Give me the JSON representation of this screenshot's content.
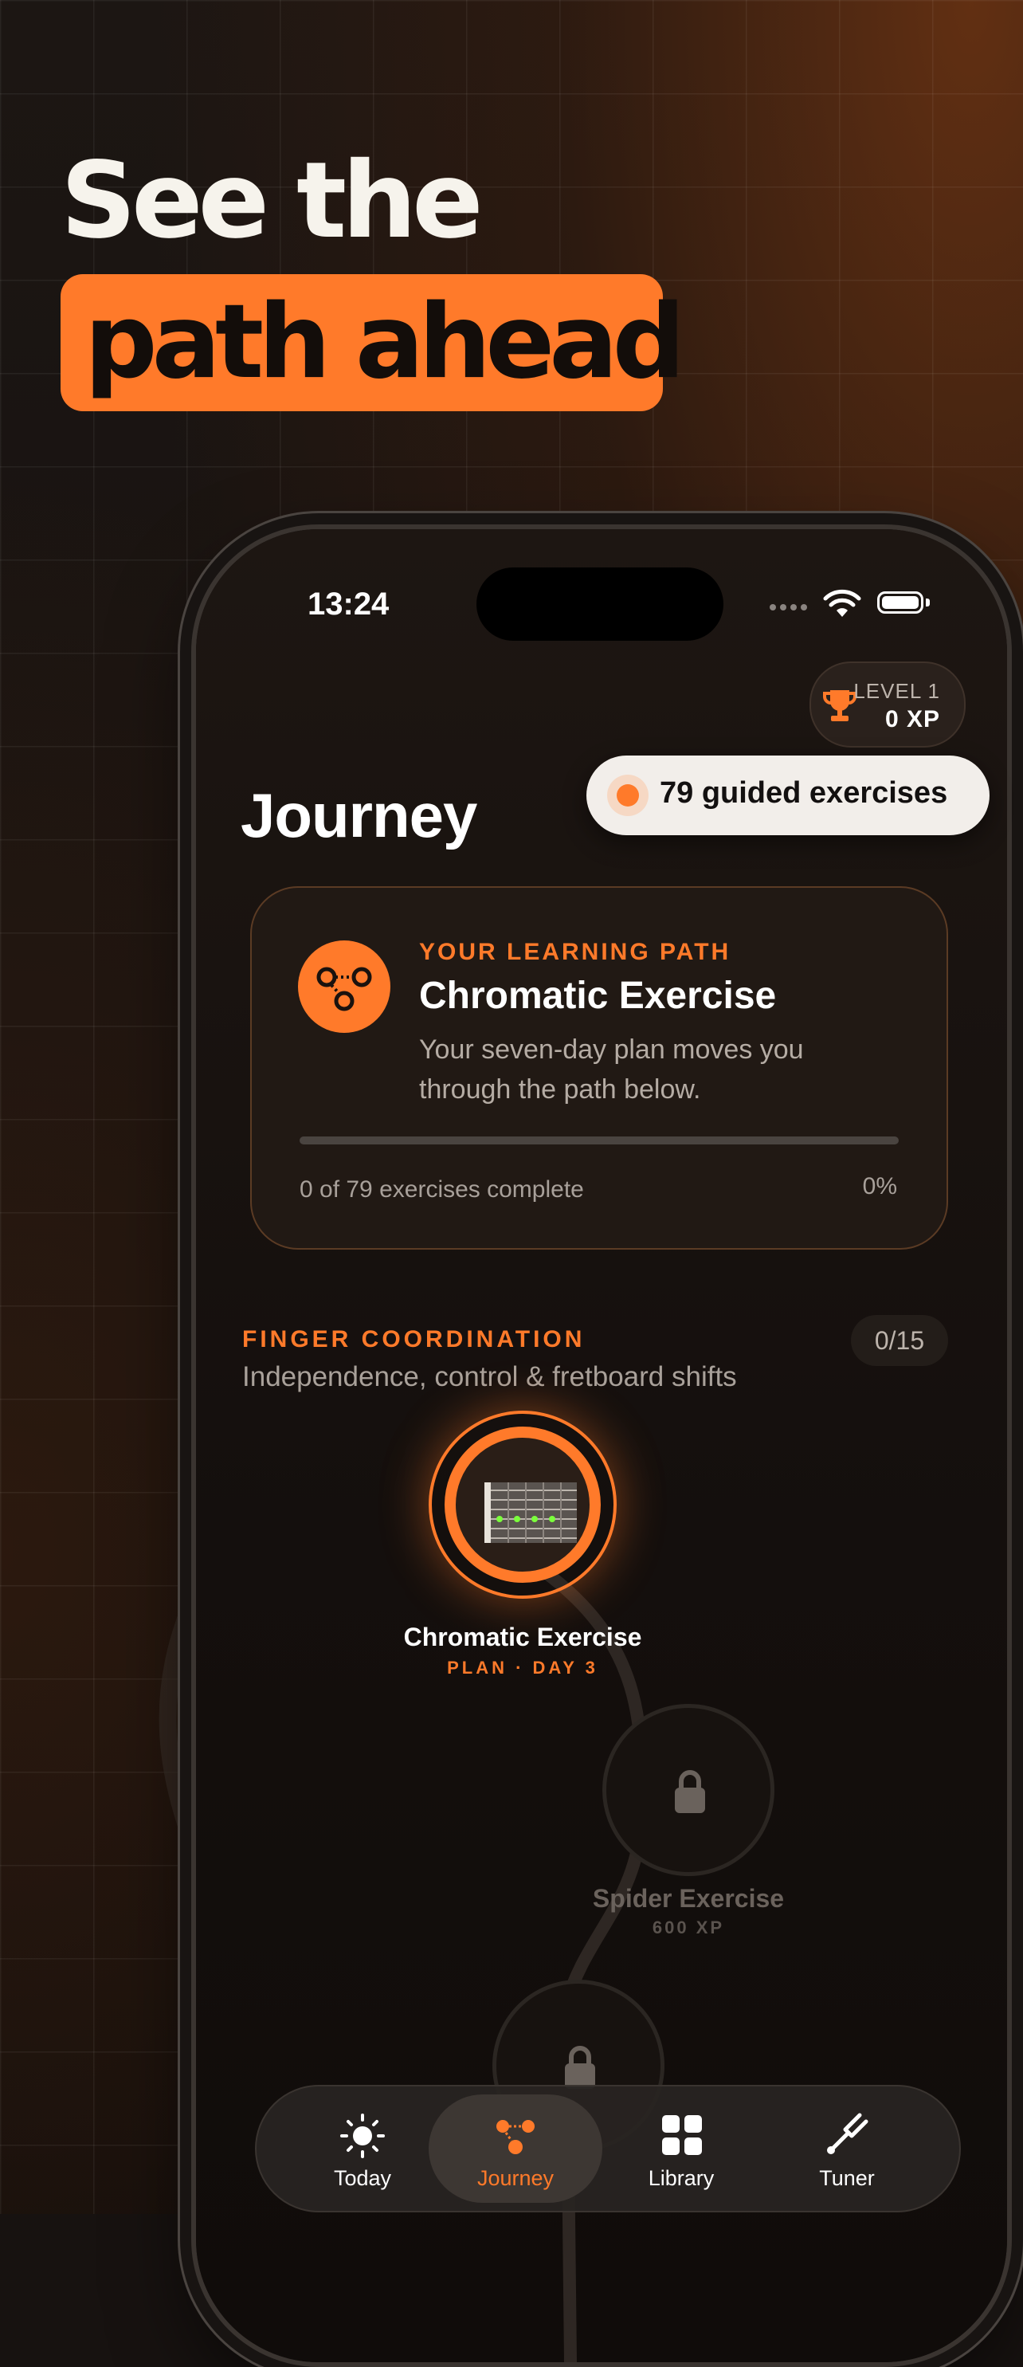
{
  "marketing": {
    "headline_line1": "See the",
    "headline_line2": "path ahead"
  },
  "status_bar": {
    "time": "13:24"
  },
  "level": {
    "label": "LEVEL 1",
    "xp": "0 XP"
  },
  "guided_badge": {
    "text": "79 guided exercises"
  },
  "page": {
    "title": "Journey"
  },
  "learning_card": {
    "eyebrow": "YOUR LEARNING PATH",
    "title": "Chromatic Exercise",
    "description": "Your seven-day plan moves you through the path below.",
    "progress_text": "0 of 79 exercises complete",
    "progress_percent": "0%",
    "progress_value": 0
  },
  "section": {
    "eyebrow": "FINGER COORDINATION",
    "subtitle": "Independence, control & fretboard shifts",
    "count": "0/15"
  },
  "nodes": [
    {
      "label": "Chromatic Exercise",
      "sub": "PLAN · DAY 3",
      "state": "active"
    },
    {
      "label": "Spider Exercise",
      "sub": "600 XP",
      "state": "locked"
    },
    {
      "label": "",
      "sub": "",
      "state": "locked"
    }
  ],
  "tabs": [
    {
      "label": "Today",
      "icon": "sun-icon",
      "active": false
    },
    {
      "label": "Journey",
      "icon": "journey-path-icon",
      "active": true
    },
    {
      "label": "Library",
      "icon": "grid-icon",
      "active": false
    },
    {
      "label": "Tuner",
      "icon": "tuning-fork-icon",
      "active": false
    }
  ],
  "colors": {
    "accent": "#ff7a2a",
    "background": "#171210",
    "card": "#211914",
    "pill": "#f2eeea"
  }
}
